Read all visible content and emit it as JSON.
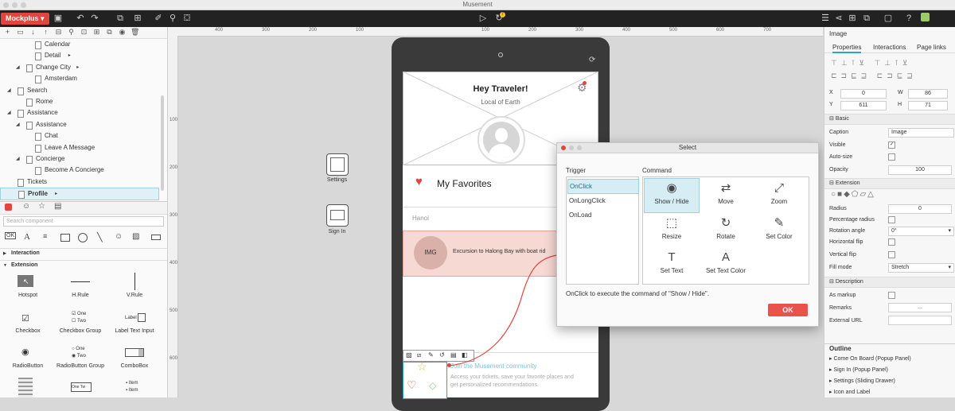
{
  "window": {
    "title": "Musement"
  },
  "toolbar": {
    "brand": "Mockplus",
    "left_icons": [
      "save-icon",
      "undo-icon",
      "redo-icon",
      "group-icon",
      "ungroup-icon",
      "brush-icon",
      "link-icon",
      "paint-bucket-icon"
    ],
    "center_icons": [
      "play-icon",
      "refresh-icon"
    ],
    "refresh_badge": "7",
    "right_icons": [
      "panel-toggle-icon",
      "share-icon",
      "export-icon",
      "copy-icon",
      "grid-icon",
      "window-icon",
      "help-icon",
      "user-icon"
    ]
  },
  "page_tree": {
    "rows": [
      {
        "label": "Calendar",
        "level": 2,
        "arrow": false,
        "dot": false
      },
      {
        "label": "Detail",
        "level": 2,
        "arrow": false,
        "dot": true
      },
      {
        "label": "Change City",
        "level": 1,
        "arrow": true,
        "dot": true
      },
      {
        "label": "Amsterdam",
        "level": 2,
        "arrow": false,
        "dot": false
      },
      {
        "label": "Search",
        "level": 0,
        "arrow": true,
        "dot": false
      },
      {
        "label": "Rome",
        "level": 1,
        "arrow": false,
        "dot": false
      },
      {
        "label": "Assistance",
        "level": 0,
        "arrow": true,
        "dot": false
      },
      {
        "label": "Assistance",
        "level": 1,
        "arrow": true,
        "dot": false
      },
      {
        "label": "Chat",
        "level": 2,
        "arrow": false,
        "dot": false
      },
      {
        "label": "Leave A Message",
        "level": 2,
        "arrow": false,
        "dot": false
      },
      {
        "label": "Concierge",
        "level": 1,
        "arrow": true,
        "dot": false
      },
      {
        "label": "Become A Concierge",
        "level": 2,
        "arrow": false,
        "dot": false
      },
      {
        "label": "Tickets",
        "level": 0,
        "arrow": false,
        "dot": false
      },
      {
        "label": "Profile",
        "level": 0,
        "arrow": false,
        "dot": true,
        "selected": true
      }
    ]
  },
  "components": {
    "search_placeholder": "Search component",
    "sections": {
      "interaction": "Interaction",
      "extension": "Extension"
    },
    "items": [
      {
        "label": "Hotspot"
      },
      {
        "label": "H.Rule"
      },
      {
        "label": "V.Rule"
      },
      {
        "label": "Checkbox"
      },
      {
        "label": "Checkbox Group",
        "opt1": "One",
        "opt2": "Two"
      },
      {
        "label": "Label Text Input",
        "mini": "Label"
      },
      {
        "label": "RadioButton"
      },
      {
        "label": "RadioButton Group",
        "opt1": "One",
        "opt2": "Two"
      },
      {
        "label": "ComboBox"
      },
      {
        "label": "",
        "mini1": "One",
        "mini2": "Tw"
      },
      {
        "label": "",
        "item1": "Item",
        "item2": "Item"
      }
    ]
  },
  "ruler": {
    "top": [
      "400",
      "300",
      "200",
      "100",
      "100",
      "200",
      "300",
      "400",
      "500",
      "600",
      "700"
    ],
    "left": [
      "100",
      "200",
      "300",
      "400",
      "500",
      "600"
    ]
  },
  "side_widgets": {
    "settings": "Settings",
    "signin": "Sign In"
  },
  "phone": {
    "greeting": "Hey Traveler!",
    "subtitle": "Local of Earth",
    "favorites": "My Favorites",
    "city": "Hanoi",
    "img_label": "IMG",
    "excursion": "Excursion to Halong Bay with boat rid",
    "community_title": "Join the Musement community",
    "community_text1": "Access your tickets, save your favorite places and",
    "community_text2": "get personalized recommendations."
  },
  "dialog": {
    "title": "Select",
    "trigger_label": "Trigger",
    "command_label": "Command",
    "triggers": [
      "OnClick",
      "OnLongClick",
      "OnLoad"
    ],
    "commands": [
      {
        "label": "Show / Hide",
        "glyph": "◉"
      },
      {
        "label": "Move",
        "glyph": "⇄"
      },
      {
        "label": "Zoom",
        "glyph": "⤢"
      },
      {
        "label": "Resize",
        "glyph": "⬚"
      },
      {
        "label": "Rotate",
        "glyph": "↻"
      },
      {
        "label": "Set Color",
        "glyph": "✎"
      },
      {
        "label": "Set Text",
        "glyph": "T"
      },
      {
        "label": "Set Text Color",
        "glyph": "A"
      }
    ],
    "description": "OnClick to execute the command of \"Show / Hide\".",
    "ok": "OK"
  },
  "inspector": {
    "element": "Image",
    "tabs": [
      "Properties",
      "Interactions",
      "Page links"
    ],
    "x": "0",
    "y": "611",
    "w": "86",
    "h": "71",
    "basic": "Basic",
    "caption_label": "Caption",
    "caption_value": "Image",
    "visible_label": "Visible",
    "autosize_label": "Auto-size",
    "opacity_label": "Opacity",
    "opacity_value": "100",
    "extension": "Extension",
    "radius_label": "Radius",
    "radius_value": "0",
    "pct_radius_label": "Percentage radius",
    "rotation_label": "Rotation angle",
    "rotation_value": "0°",
    "hflip_label": "Horizontal flip",
    "vflip_label": "Vertical flip",
    "fill_label": "Fill mode",
    "fill_value": "Stretch",
    "description": "Description",
    "markup_label": "As markup",
    "remarks_label": "Remarks",
    "remarks_value": "...",
    "url_label": "External URL"
  },
  "outline": {
    "title": "Outline",
    "items": [
      "Come On Board (Popup Panel)",
      "Sign In (Popup Panel)",
      "Settings (Sliding Drawer)",
      "Icon and Label"
    ]
  },
  "colors": {
    "brand": "#e0463f",
    "accent": "#2aa6c8",
    "heart": "#e0463f",
    "ok": "#e8544b"
  }
}
